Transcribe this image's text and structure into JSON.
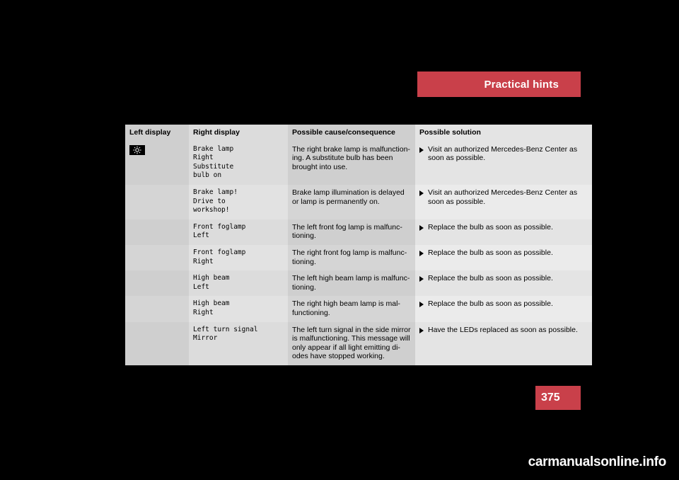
{
  "header": {
    "title": "Practical hints"
  },
  "page": {
    "number": "375",
    "watermark": "carmanualsonline.info"
  },
  "table": {
    "columns": [
      "Left display",
      "Right display",
      "Possible cause/consequence",
      "Possible solution"
    ],
    "rows": [
      {
        "left_icon": "lamp-telltale-icon",
        "right": "Brake lamp\nRight\nSubstitute\nbulb on",
        "cause": "The right brake lamp is malfunction-\ning. A substitute bulb has been\nbrought into use.",
        "solution": "Visit an authorized Mercedes-Benz Center as\nsoon as possible."
      },
      {
        "left_icon": "",
        "right": "Brake lamp!\nDrive to\nworkshop!",
        "cause": "Brake lamp illumination is delayed\nor lamp is permanently on.",
        "solution": "Visit an authorized Mercedes-Benz Center as\nsoon as possible."
      },
      {
        "left_icon": "",
        "right": "Front foglamp\nLeft",
        "cause": "The left front fog lamp is malfunc-\ntioning.",
        "solution": "Replace the bulb as soon as possible."
      },
      {
        "left_icon": "",
        "right": "Front foglamp\nRight",
        "cause": "The right front fog lamp is malfunc-\ntioning.",
        "solution": "Replace the bulb as soon as possible."
      },
      {
        "left_icon": "",
        "right": "High beam\nLeft",
        "cause": "The left high beam lamp is malfunc-\ntioning.",
        "solution": "Replace the bulb as soon as possible."
      },
      {
        "left_icon": "",
        "right": "High beam\nRight",
        "cause": "The right high beam lamp is mal-\nfunctioning.",
        "solution": "Replace the bulb as soon as possible."
      },
      {
        "left_icon": "",
        "right": "Left turn signal\nMirror",
        "cause": "The left turn signal in the side mirror\nis malfunctioning. This message will\nonly appear if all light emitting di-\nodes have stopped working.",
        "solution": "Have the LEDs replaced as soon as possible."
      }
    ]
  },
  "colors": {
    "accent": "#c9404a",
    "header_row": "#d5d5d5",
    "page_bg": "#000000"
  }
}
